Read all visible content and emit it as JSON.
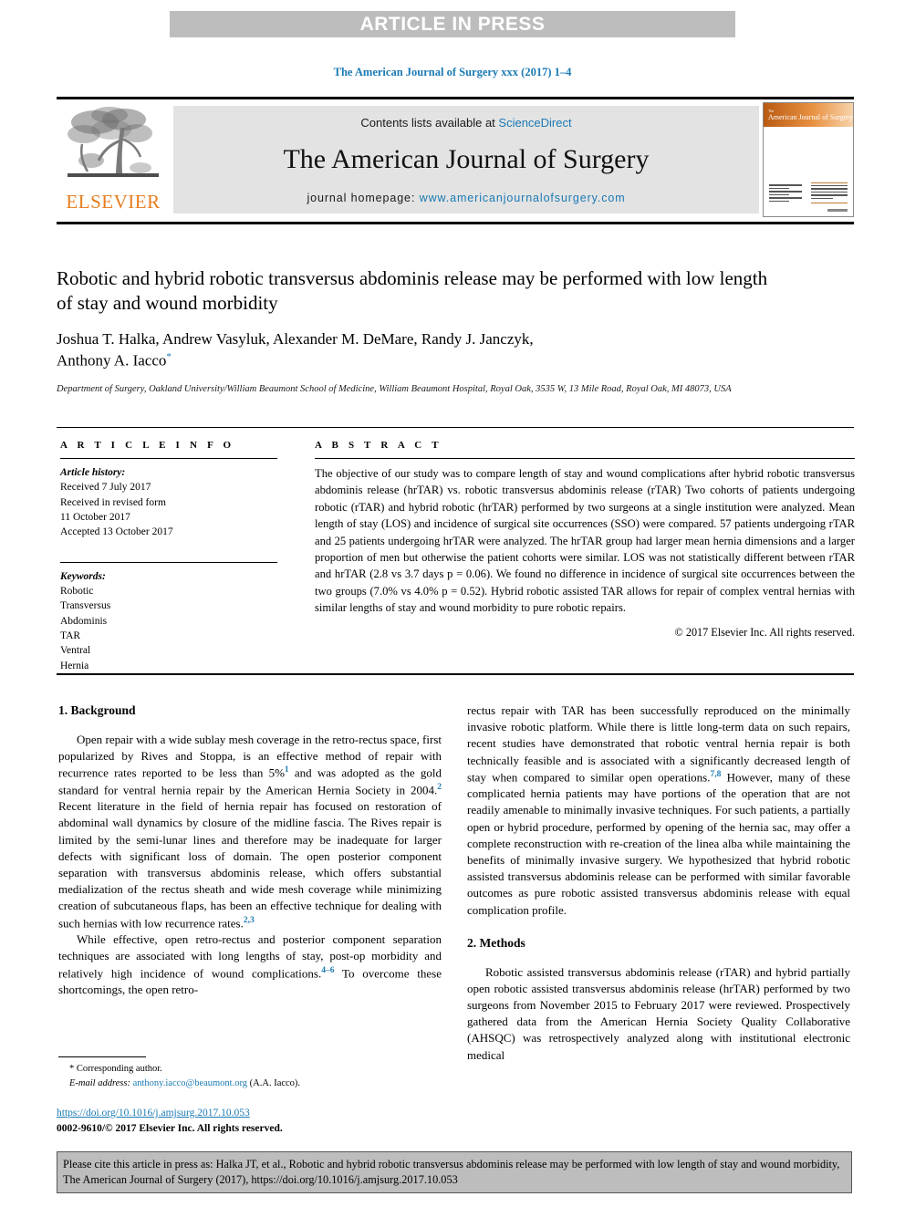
{
  "banner": {
    "text": "ARTICLE IN PRESS"
  },
  "running_head": "The American Journal of Surgery xxx (2017) 1–4",
  "masthead": {
    "contents_prefix": "Contents lists available at ",
    "sciencedirect": "ScienceDirect",
    "journal_title": "The American Journal of Surgery",
    "homepage_prefix": "journal homepage: ",
    "homepage_url": "www.americanjournalofsurgery.com",
    "publisher": "ELSEVIER",
    "cover": {
      "small_line": "The",
      "title": "American Journal of Surgery"
    }
  },
  "article": {
    "title": "Robotic and hybrid robotic transversus abdominis release may be performed with low length of stay and wound morbidity",
    "authors_line1": "Joshua T. Halka, Andrew Vasyluk, Alexander M. DeMare, Randy J. Janczyk,",
    "authors_line2": "Anthony A. Iacco",
    "corresponding_marker": "*",
    "affiliation": "Department of Surgery, Oakland University/William Beaumont School of Medicine, William Beaumont Hospital, Royal Oak, 3535 W, 13 Mile Road, Royal Oak, MI 48073, USA"
  },
  "article_info": {
    "label": "A R T I C L E   I N F O",
    "history_heading": "Article history:",
    "history": [
      "Received 7 July 2017",
      "Received in revised form",
      "11 October 2017",
      "Accepted 13 October 2017"
    ],
    "keywords_heading": "Keywords:",
    "keywords": [
      "Robotic",
      "Transversus",
      "Abdominis",
      "TAR",
      "Ventral",
      "Hernia"
    ]
  },
  "abstract": {
    "label": "A B S T R A C T",
    "text": "The objective of our study was to compare length of stay and wound complications after hybrid robotic transversus abdominis release (hrTAR) vs. robotic transversus abdominis release (rTAR) Two cohorts of patients undergoing robotic (rTAR) and hybrid robotic (hrTAR) performed by two surgeons at a single institution were analyzed. Mean length of stay (LOS) and incidence of surgical site occurrences (SSO) were compared. 57 patients undergoing rTAR and 25 patients undergoing hrTAR were analyzed. The hrTAR group had larger mean hernia dimensions and a larger proportion of men but otherwise the patient cohorts were similar. LOS was not statistically different between rTAR and hrTAR (2.8 vs 3.7 days p = 0.06). We found no difference in incidence of surgical site occurrences between the two groups (7.0% vs 4.0% p = 0.52). Hybrid robotic assisted TAR allows for repair of complex ventral hernias with similar lengths of stay and wound morbidity to pure robotic repairs.",
    "copyright": "© 2017 Elsevier Inc. All rights reserved."
  },
  "sections": {
    "background": {
      "heading": "1. Background",
      "para1_a": "Open repair with a wide sublay mesh coverage in the retro-rectus space, first popularized by Rives and Stoppa, is an effective method of repair with recurrence rates reported to be less than 5%",
      "cite1": "1",
      "para1_b": " and was adopted as the gold standard for ventral hernia repair by the American Hernia Society in 2004.",
      "cite2": "2",
      "para1_c": " Recent literature in the field of hernia repair has focused on restoration of abdominal wall dynamics by closure of the midline fascia. The Rives repair is limited by the semi-lunar lines and therefore may be inadequate for larger defects with significant loss of domain. The open posterior component separation with transversus abdominis release, which offers substantial medialization of the rectus sheath and wide mesh coverage while minimizing creation of subcutaneous flaps, has been an effective technique for dealing with such hernias with low recurrence rates.",
      "cite3": "2,3",
      "para2_a": "While effective, open retro-rectus and posterior component separation techniques are associated with long lengths of stay, post-op morbidity and relatively high incidence of wound complications.",
      "cite4": "4–6",
      "para2_b": " To overcome these shortcomings, the open retro-rectus repair with TAR has been successfully reproduced on the minimally invasive robotic platform. While there is little long-term data on such repairs, recent studies have demonstrated that robotic ventral hernia repair is both technically feasible and is associated with a significantly decreased length of stay when compared to similar open operations.",
      "cite5": "7,8",
      "para2_c": " However, many of these complicated hernia patients may have portions of the operation that are not readily amenable to minimally invasive techniques. For such patients, a partially open or hybrid procedure, performed by opening of the hernia sac, may offer a complete reconstruction with re-creation of the linea alba while maintaining the benefits of minimally invasive surgery. We hypothesized that hybrid robotic assisted transversus abdominis release can be performed with similar favorable outcomes as pure robotic assisted transversus abdominis release with equal complication profile."
    },
    "methods": {
      "heading": "2. Methods",
      "para1": "Robotic assisted transversus abdominis release (rTAR) and hybrid partially open robotic assisted transversus abdominis release (hrTAR) performed by two surgeons from November 2015 to February 2017 were reviewed. Prospectively gathered data from the American Hernia Society Quality Collaborative (AHSQC) was retrospectively analyzed along with institutional electronic medical"
    }
  },
  "footnotes": {
    "corresponding": "* Corresponding author.",
    "email_label": "E-mail address:",
    "email": "anthony.iacco@beaumont.org",
    "email_suffix": "(A.A. Iacco).",
    "doi": "https://doi.org/10.1016/j.amjsurg.2017.10.053",
    "issn": "0002-9610/© 2017 Elsevier Inc. All rights reserved."
  },
  "cite_box": {
    "text": "Please cite this article in press as: Halka JT, et al., Robotic and hybrid robotic transversus abdominis release may be performed with low length of stay and wound morbidity, The American Journal of Surgery (2017), https://doi.org/10.1016/j.amjsurg.2017.10.053"
  },
  "colors": {
    "accent_blue": "#1a7ab4",
    "elsevier_orange": "#e87d1e",
    "banner_gray": "#bdbdbd",
    "masthead_gray": "#e3e3e3"
  }
}
